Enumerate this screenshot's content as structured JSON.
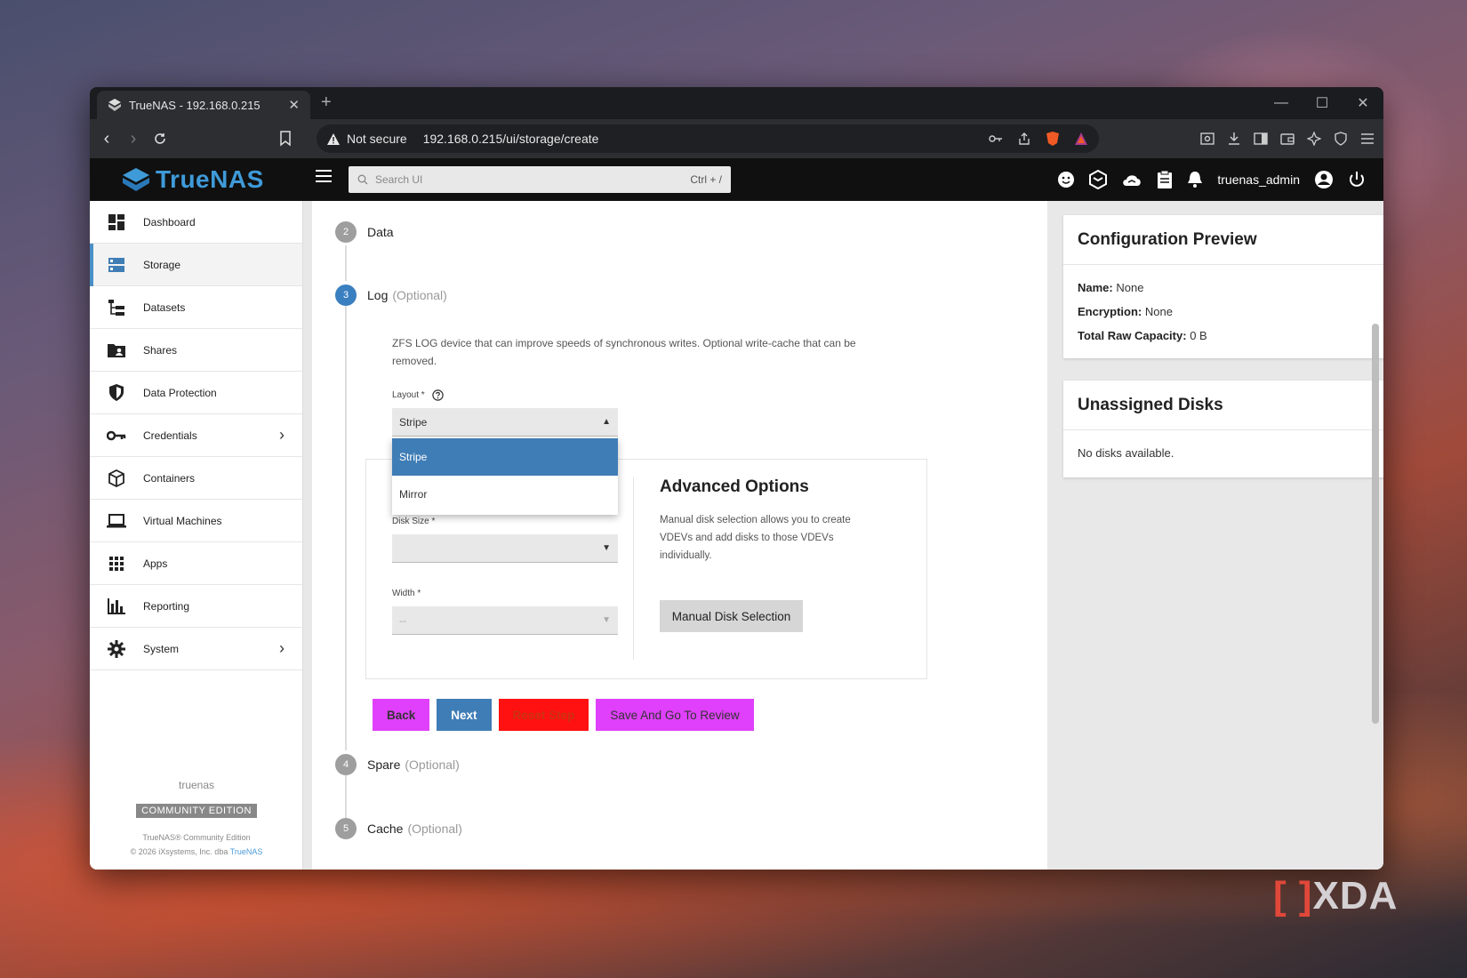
{
  "browser": {
    "tab_title": "TrueNAS - 192.168.0.215",
    "tab_close": "✕",
    "new_tab": "+",
    "security_label": "Not secure",
    "url": "192.168.0.215/ui/storage/create",
    "window_controls": [
      "—",
      "☐",
      "✕"
    ]
  },
  "header": {
    "logo_text": "TrueNAS",
    "search_placeholder": "Search UI",
    "search_shortcut": "Ctrl + /",
    "username": "truenas_admin"
  },
  "sidebar": {
    "items": [
      {
        "label": "Dashboard",
        "icon": "dashboard-icon"
      },
      {
        "label": "Storage",
        "icon": "storage-icon",
        "active": true
      },
      {
        "label": "Datasets",
        "icon": "datasets-icon"
      },
      {
        "label": "Shares",
        "icon": "shares-icon"
      },
      {
        "label": "Data Protection",
        "icon": "shield-icon"
      },
      {
        "label": "Credentials",
        "icon": "key-icon",
        "chevron": true
      },
      {
        "label": "Containers",
        "icon": "cube-icon"
      },
      {
        "label": "Virtual Machines",
        "icon": "laptop-icon"
      },
      {
        "label": "Apps",
        "icon": "apps-grid-icon"
      },
      {
        "label": "Reporting",
        "icon": "bar-chart-icon"
      },
      {
        "label": "System",
        "icon": "gear-icon",
        "chevron": true
      }
    ],
    "hostname": "truenas",
    "edition": "COMMUNITY EDITION",
    "copyright_line1": "TrueNAS® Community Edition",
    "copyright_line2": "© 2026 iXsystems, Inc. dba",
    "copyright_link": "TrueNAS"
  },
  "wizard": {
    "steps": [
      {
        "num": "2",
        "label": "Data",
        "optional": ""
      },
      {
        "num": "3",
        "label": "Log",
        "optional": "(Optional)",
        "active": true
      },
      {
        "num": "4",
        "label": "Spare",
        "optional": "(Optional)"
      },
      {
        "num": "5",
        "label": "Cache",
        "optional": "(Optional)"
      }
    ],
    "log_description": "ZFS LOG device that can improve speeds of synchronous writes. Optional write-cache that can be removed.",
    "layout_label": "Layout *",
    "layout_value": "Stripe",
    "layout_options": [
      "Stripe",
      "Mirror"
    ],
    "disk_size_label": "Disk Size *",
    "disk_size_value": "",
    "width_label": "Width *",
    "width_value": "--",
    "advanced_title": "Advanced Options",
    "advanced_desc": "Manual disk selection allows you to create VDEVs and add disks to those VDEVs individually.",
    "manual_button": "Manual Disk Selection",
    "buttons": {
      "back": "Back",
      "next": "Next",
      "reset": "Reset Step",
      "save": "Save And Go To Review"
    }
  },
  "preview": {
    "title": "Configuration Preview",
    "name_label": "Name:",
    "name_value": "None",
    "encryption_label": "Encryption:",
    "encryption_value": "None",
    "capacity_label": "Total Raw Capacity:",
    "capacity_value": "0 B"
  },
  "unassigned": {
    "title": "Unassigned Disks",
    "message": "No disks available."
  },
  "watermark": "XDA",
  "colors": {
    "accent": "#3f7db6",
    "logo": "#3f9ad8",
    "magenta": "#e040fb",
    "red": "#ff1111"
  }
}
